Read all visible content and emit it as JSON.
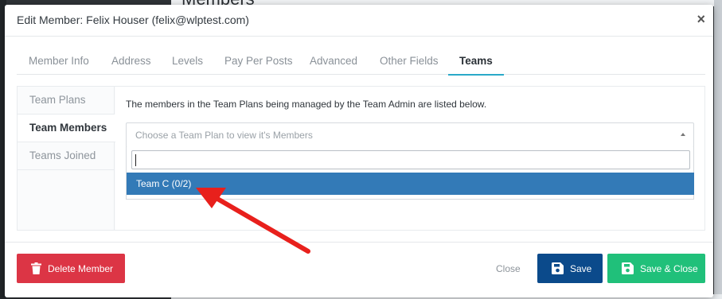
{
  "background": {
    "page_title": "Members"
  },
  "modal": {
    "title": "Edit Member: Felix Houser (felix@wlptest.com)",
    "close_glyph": "×"
  },
  "tabs": [
    {
      "label": "Member Info",
      "active": false
    },
    {
      "label": "Address",
      "active": false
    },
    {
      "label": "Levels",
      "active": false
    },
    {
      "label": "Pay Per Posts",
      "active": false
    },
    {
      "label": "Advanced",
      "active": false
    },
    {
      "label": "Other Fields",
      "active": false
    },
    {
      "label": "Teams",
      "active": true
    }
  ],
  "subnav": [
    {
      "label": "Team Plans",
      "active": false
    },
    {
      "label": "Team Members",
      "active": true
    },
    {
      "label": "Teams Joined",
      "active": false
    }
  ],
  "content": {
    "description": "The members in the Team Plans being managed by the Team Admin are listed below.",
    "select_placeholder": "Choose a Team Plan to view it's Members",
    "search_value": "",
    "options": [
      {
        "label": "Team C (0/2)",
        "highlighted": true
      }
    ]
  },
  "footer": {
    "delete_label": "Delete Member",
    "close_label": "Close",
    "save_label": "Save",
    "save_close_label": "Save & Close"
  },
  "colors": {
    "accent_tab": "#2aa9c9",
    "highlight": "#337ab7",
    "delete": "#dc3545",
    "save": "#0b4a8b",
    "save_close": "#20c07a",
    "annotation_arrow": "#e8201c"
  },
  "icons": {
    "delete": "trash-icon",
    "save": "floppy-disk-icon",
    "save_close": "floppy-disk-icon"
  }
}
